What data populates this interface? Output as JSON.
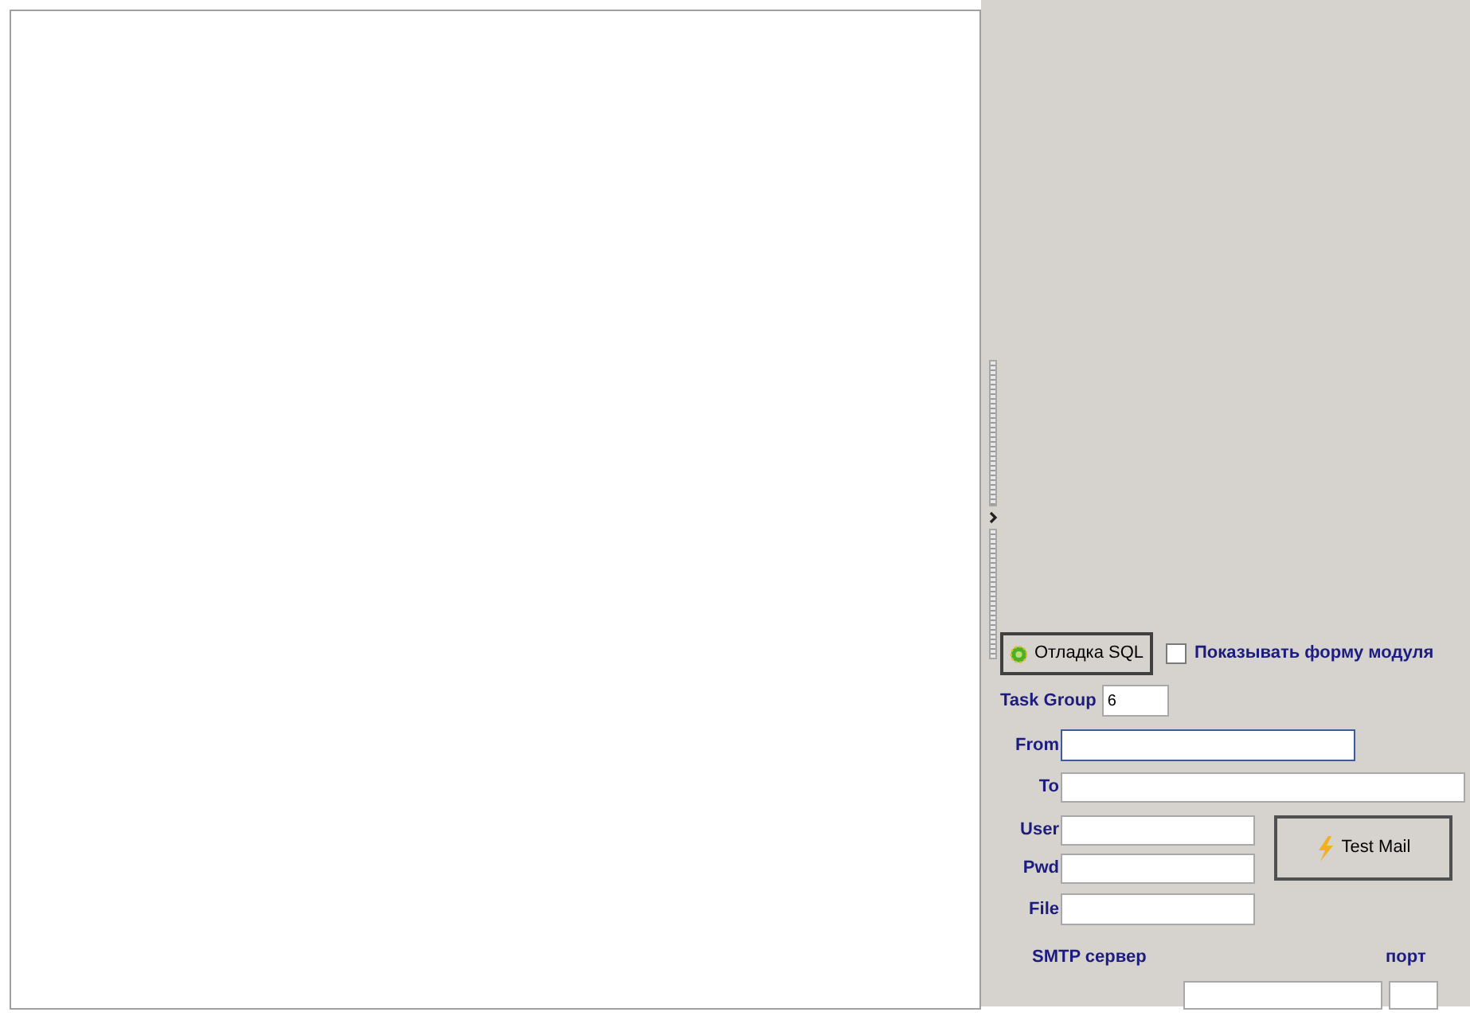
{
  "debug_button": {
    "label": "Отладка SQL"
  },
  "show_module_form": {
    "label": "Показывать форму модуля",
    "checked": false
  },
  "task_group": {
    "label": "Task Group",
    "value": "6"
  },
  "fields": [
    {
      "label": "From",
      "focused": true
    },
    {
      "label": "To",
      "focused": false
    },
    {
      "label": "User",
      "focused": false
    },
    {
      "label": "Pwd",
      "focused": false
    },
    {
      "label": "File",
      "focused": false
    }
  ],
  "test_mail_button": {
    "label": "Test Mail"
  },
  "smtp": {
    "server_label": "SMTP сервер",
    "port_label": "порт"
  }
}
